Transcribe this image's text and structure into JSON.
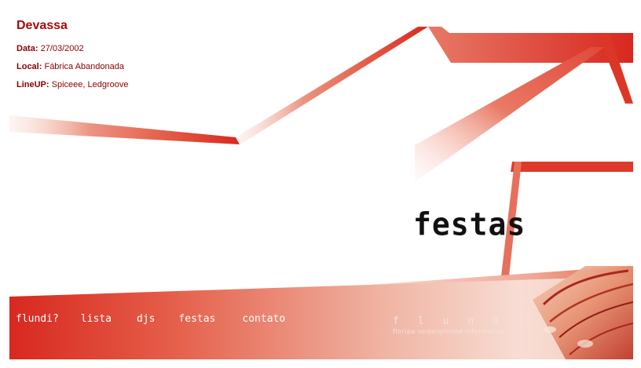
{
  "event": {
    "title": "Devassa",
    "date_label": "Data:",
    "date_value": "27/03/2002",
    "local_label": "Local:",
    "local_value": "Fábrica Abandonada",
    "lineup_label": "LineUP:",
    "lineup_value": "Spiceee, Ledgroove"
  },
  "section_title": "festas",
  "nav": {
    "items": [
      {
        "label": "flundi?"
      },
      {
        "label": "lista"
      },
      {
        "label": "djs"
      },
      {
        "label": "festas"
      },
      {
        "label": "contato"
      }
    ]
  },
  "brand": {
    "logo": "flundi",
    "tagline": "floripa underground information"
  },
  "colors": {
    "accent": "#d8281f",
    "accent_light": "#f4c4b5",
    "title_red": "#a80808",
    "text_red": "#8a0000"
  },
  "icons": {
    "corner_image": "photo-collage-icon"
  }
}
